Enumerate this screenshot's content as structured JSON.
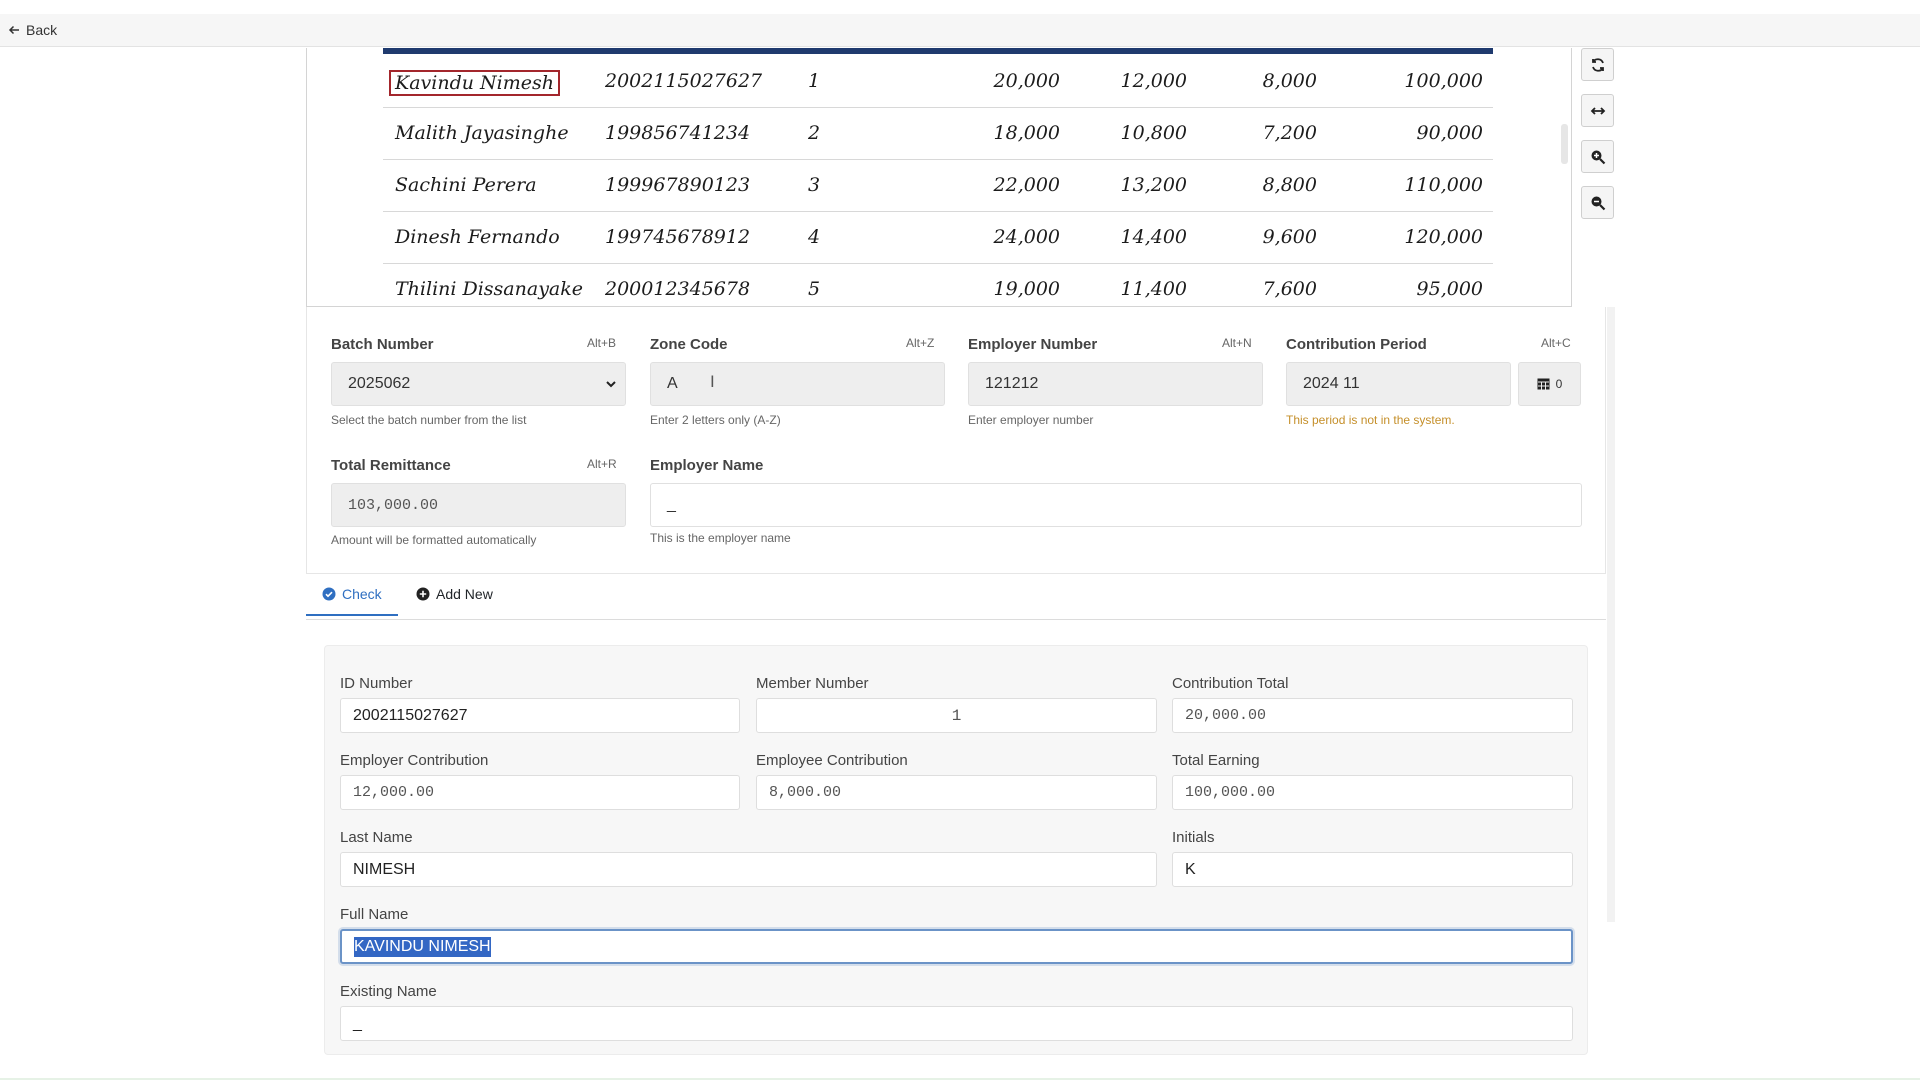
{
  "nav": {
    "back_label": "Back"
  },
  "scan_rows": [
    {
      "name": "Kavindu Nimesh",
      "id": "2002115027627",
      "no": "1",
      "a": "20,000",
      "b": "12,000",
      "c": "8,000",
      "d": "100,000"
    },
    {
      "name": "Malith Jayasinghe",
      "id": "199856741234",
      "no": "2",
      "a": "18,000",
      "b": "10,800",
      "c": "7,200",
      "d": "90,000"
    },
    {
      "name": "Sachini Perera",
      "id": "199967890123",
      "no": "3",
      "a": "22,000",
      "b": "13,200",
      "c": "8,800",
      "d": "110,000"
    },
    {
      "name": "Dinesh Fernando",
      "id": "199745678912",
      "no": "4",
      "a": "24,000",
      "b": "14,400",
      "c": "9,600",
      "d": "120,000"
    },
    {
      "name": "Thilini Dissanayake",
      "id": "200012345678",
      "no": "5",
      "a": "19,000",
      "b": "11,400",
      "c": "7,600",
      "d": "95,000"
    }
  ],
  "toolbar": {
    "icons": [
      "refresh-icon",
      "fit-width-icon",
      "zoom-in-icon",
      "zoom-out-icon"
    ]
  },
  "form": {
    "batch_number": {
      "label": "Batch Number",
      "shortcut": "Alt+B",
      "value": "2025062",
      "help": "Select the batch number from the list"
    },
    "zone_code": {
      "label": "Zone Code",
      "shortcut": "Alt+Z",
      "value": "A",
      "help": "Enter 2 letters only (A-Z)"
    },
    "employer_number": {
      "label": "Employer Number",
      "shortcut": "Alt+N",
      "value": "121212",
      "help": "Enter employer number"
    },
    "contribution_period": {
      "label": "Contribution Period",
      "shortcut": "Alt+C",
      "value": "2024 11",
      "calendar_count": "0",
      "help": "This period is not in the system."
    },
    "total_remittance": {
      "label": "Total Remittance",
      "shortcut": "Alt+R",
      "value": "103,000.00",
      "help": "Amount will be formatted automatically"
    },
    "employer_name": {
      "label": "Employer Name",
      "value": "_",
      "help": "This is the employer name"
    }
  },
  "tabs": {
    "check": "Check",
    "add_new": "Add New"
  },
  "member": {
    "id_number": {
      "label": "ID Number",
      "value": "2002115027627"
    },
    "member_number": {
      "label": "Member Number",
      "value": "1"
    },
    "contribution_total": {
      "label": "Contribution Total",
      "value": "20,000.00"
    },
    "employer_contribution": {
      "label": "Employer Contribution",
      "value": "12,000.00"
    },
    "employee_contribution": {
      "label": "Employee Contribution",
      "value": "8,000.00"
    },
    "total_earning": {
      "label": "Total Earning",
      "value": "100,000.00"
    },
    "last_name": {
      "label": "Last Name",
      "value": "NIMESH"
    },
    "initials": {
      "label": "Initials",
      "value": "K"
    },
    "full_name": {
      "label": "Full Name",
      "value": "KAVINDU NIMESH"
    },
    "existing_name": {
      "label": "Existing Name",
      "value": "_"
    }
  },
  "colors": {
    "accent": "#2f6fc1",
    "scan_header": "#1f3a6e",
    "highlight_box": "#a3262c",
    "warning": "#c58f2a",
    "selection": "#3367c4"
  }
}
